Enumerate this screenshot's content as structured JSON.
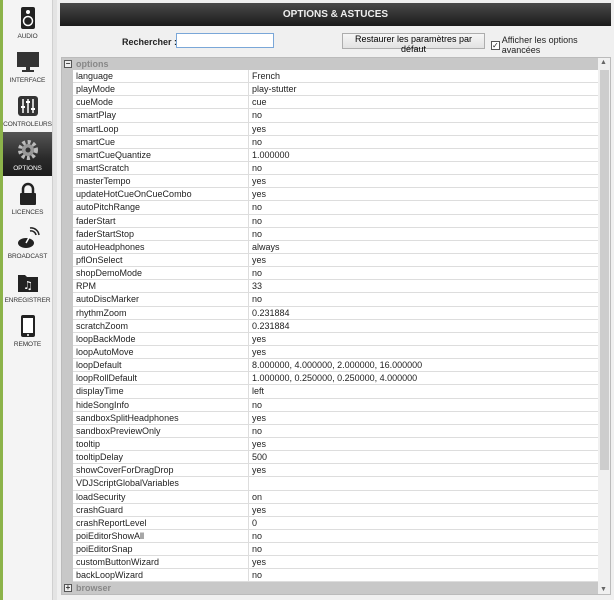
{
  "title": "OPTIONS & ASTUCES",
  "sidebar": [
    {
      "label": "AUDIO",
      "icon": "speaker-icon"
    },
    {
      "label": "INTERFACE",
      "icon": "monitor-icon"
    },
    {
      "label": "CONTROLEURS",
      "icon": "mixer-sliders-icon"
    },
    {
      "label": "OPTIONS",
      "icon": "gear-icon",
      "selected": true
    },
    {
      "label": "LICENCES",
      "icon": "lock-icon"
    },
    {
      "label": "BROADCAST",
      "icon": "broadcast-icon"
    },
    {
      "label": "ENREGISTRER",
      "icon": "music-folder-icon"
    },
    {
      "label": "REMOTE",
      "icon": "tablet-icon"
    }
  ],
  "search": {
    "label": "Rechercher :",
    "value": ""
  },
  "restore_label": "Restaurer les paramètres par défaut",
  "advanced": {
    "label": "Afficher les options avancées",
    "checked": true
  },
  "groups": [
    {
      "name": "options",
      "expanded": true
    },
    {
      "name": "browser",
      "expanded": false
    }
  ],
  "rows": [
    [
      "language",
      "French"
    ],
    [
      "playMode",
      "play-stutter"
    ],
    [
      "cueMode",
      "cue"
    ],
    [
      "smartPlay",
      "no"
    ],
    [
      "smartLoop",
      "yes"
    ],
    [
      "smartCue",
      "no"
    ],
    [
      "smartCueQuantize",
      "1.000000"
    ],
    [
      "smartScratch",
      "no"
    ],
    [
      "masterTempo",
      "yes"
    ],
    [
      "updateHotCueOnCueCombo",
      "yes"
    ],
    [
      "autoPitchRange",
      "no"
    ],
    [
      "faderStart",
      "no"
    ],
    [
      "faderStartStop",
      "no"
    ],
    [
      "autoHeadphones",
      "always"
    ],
    [
      "pflOnSelect",
      "yes"
    ],
    [
      "shopDemoMode",
      "no"
    ],
    [
      "RPM",
      "33"
    ],
    [
      "autoDiscMarker",
      "no"
    ],
    [
      "rhythmZoom",
      "0.231884"
    ],
    [
      "scratchZoom",
      "0.231884"
    ],
    [
      "loopBackMode",
      "yes"
    ],
    [
      "loopAutoMove",
      "yes"
    ],
    [
      "loopDefault",
      "8.000000, 4.000000, 2.000000, 16.000000"
    ],
    [
      "loopRollDefault",
      "1.000000, 0.250000, 0.250000, 4.000000"
    ],
    [
      "displayTime",
      "left"
    ],
    [
      "hideSongInfo",
      "no"
    ],
    [
      "sandboxSplitHeadphones",
      "yes"
    ],
    [
      "sandboxPreviewOnly",
      "no"
    ],
    [
      "tooltip",
      "yes"
    ],
    [
      "tooltipDelay",
      "500"
    ],
    [
      "showCoverForDragDrop",
      "yes"
    ],
    [
      "VDJScriptGlobalVariables",
      ""
    ],
    [
      "loadSecurity",
      "on"
    ],
    [
      "crashGuard",
      "yes"
    ],
    [
      "crashReportLevel",
      "0"
    ],
    [
      "poiEditorShowAll",
      "no"
    ],
    [
      "poiEditorSnap",
      "no"
    ],
    [
      "customButtonWizard",
      "yes"
    ],
    [
      "backLoopWizard",
      "no"
    ]
  ]
}
